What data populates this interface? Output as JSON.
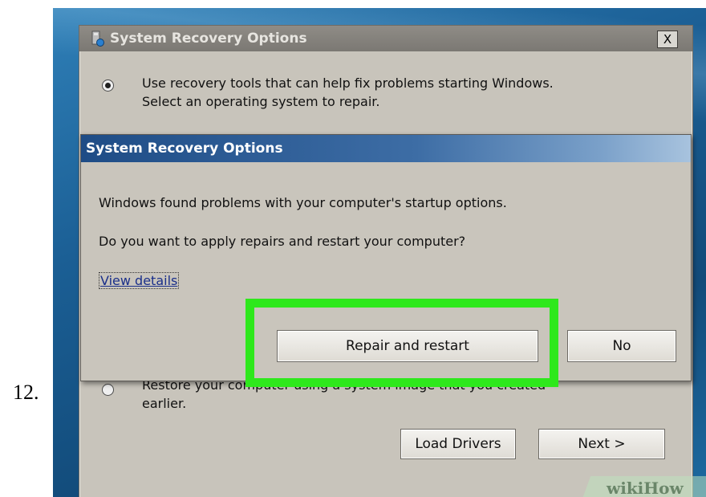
{
  "step": {
    "number": "12."
  },
  "outer_dialog": {
    "title": "System Recovery Options",
    "close_label": "X",
    "option1": {
      "line1": "Use recovery tools that can help fix problems starting Windows.",
      "line2": "Select an operating system to repair.",
      "selected": true
    },
    "option2": {
      "line1": "Restore your computer using a system image that you created",
      "line2": "earlier.",
      "selected": false
    },
    "buttons": {
      "load_drivers": "Load Drivers",
      "next": "Next >"
    }
  },
  "inner_dialog": {
    "title": "System Recovery Options",
    "message1": "Windows found problems with your computer's startup options.",
    "message2": "Do you want to apply repairs and restart your computer?",
    "link": "View details",
    "buttons": {
      "repair": "Repair and restart",
      "no": "No"
    }
  },
  "highlight": {
    "color": "#2ee81c"
  },
  "watermark": "wikiHow"
}
